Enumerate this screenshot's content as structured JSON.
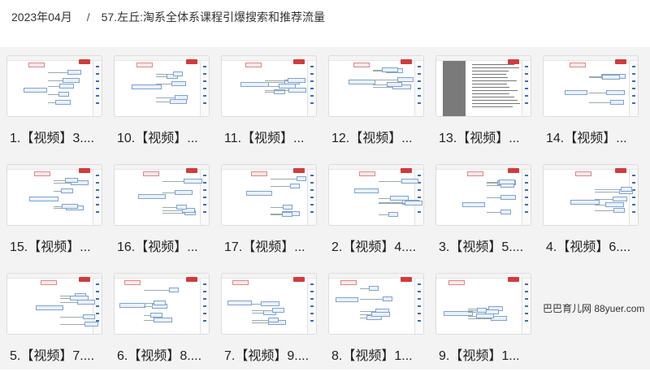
{
  "breadcrumb": {
    "date": "2023年04月",
    "separator": "/",
    "folder": "57.左丘:淘系全体系课程引爆搜索和推荐流量"
  },
  "files": [
    {
      "label": "1.【视频】3....",
      "thumb_style": "mindmap"
    },
    {
      "label": "10.【视频】...",
      "thumb_style": "mindmap"
    },
    {
      "label": "11.【视频】...",
      "thumb_style": "mindmap"
    },
    {
      "label": "12.【视频】...",
      "thumb_style": "mindmap"
    },
    {
      "label": "13.【视频】...",
      "thumb_style": "list-dark"
    },
    {
      "label": "14.【视频】...",
      "thumb_style": "mindmap"
    },
    {
      "label": "15.【视频】...",
      "thumb_style": "mindmap"
    },
    {
      "label": "16.【视频】...",
      "thumb_style": "mindmap"
    },
    {
      "label": "17.【视频】...",
      "thumb_style": "mindmap"
    },
    {
      "label": "2.【视频】4....",
      "thumb_style": "mindmap"
    },
    {
      "label": "3.【视频】5....",
      "thumb_style": "mindmap"
    },
    {
      "label": "4.【视频】6....",
      "thumb_style": "mindmap"
    },
    {
      "label": "5.【视频】7....",
      "thumb_style": "mindmap"
    },
    {
      "label": "6.【视频】8....",
      "thumb_style": "mindmap"
    },
    {
      "label": "7.【视频】9....",
      "thumb_style": "mindmap"
    },
    {
      "label": "8.【视频】1...",
      "thumb_style": "mindmap"
    },
    {
      "label": "9.【视频】1...",
      "thumb_style": "mindmap"
    }
  ],
  "watermark": "巴巴育儿网 88yuer.com",
  "colors": {
    "panel_background": "#f3f3f3",
    "node_border": "#7fa3d0",
    "logo_red": "#d23b3b"
  }
}
